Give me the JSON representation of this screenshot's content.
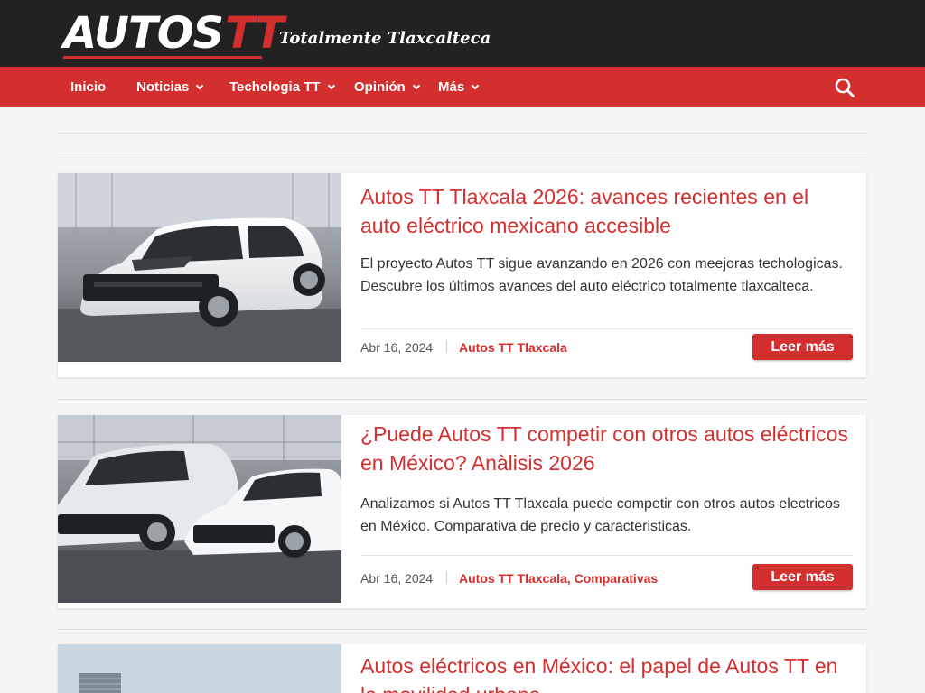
{
  "header": {
    "logo_main": "AUTOS",
    "logo_accent": "TT",
    "tagline": "Totalmente Tlaxcalteca"
  },
  "nav": {
    "items": [
      {
        "label": "Inicio"
      },
      {
        "label": "Noticias"
      },
      {
        "label": "Techologia TT"
      },
      {
        "label": "Opinión"
      },
      {
        "label": "Más"
      }
    ]
  },
  "posts": [
    {
      "title": "Autos TT Tlaxcala 2026: avances recientes en el auto eléctrico mexicano accesible",
      "excerpt": "El proyecto Autos TT sigue avanzando en 2026 con meejoras techologicas. Descubre los últimos avances del auto eléctrico totalmente tlaxcalteca.",
      "date": "Abr 16, 2024",
      "category": "Autos TT Tlaxcala",
      "button": "Leer más"
    },
    {
      "title": "¿Puede Autos TT competir con otros autos eléctricos en México? Anàlisis 2026",
      "excerpt": "Analizamos si Autos TT Tlaxcala puede competir con otros autos electricos en México. Comparativa de precio y caracteristicas.",
      "date": "Abr 16, 2024",
      "category": "Autos TT Tlaxcala, Comparativas",
      "button": "Leer más"
    },
    {
      "title": "Autos eléctricos en México: el papel de Autos TT en la movilidad urbana"
    }
  ],
  "colors": {
    "accent": "#d32f2f",
    "topbar": "#222222",
    "background": "#f5f5f5"
  },
  "icons": {
    "search": "search-icon",
    "dropdown": "chevron-down-icon"
  }
}
